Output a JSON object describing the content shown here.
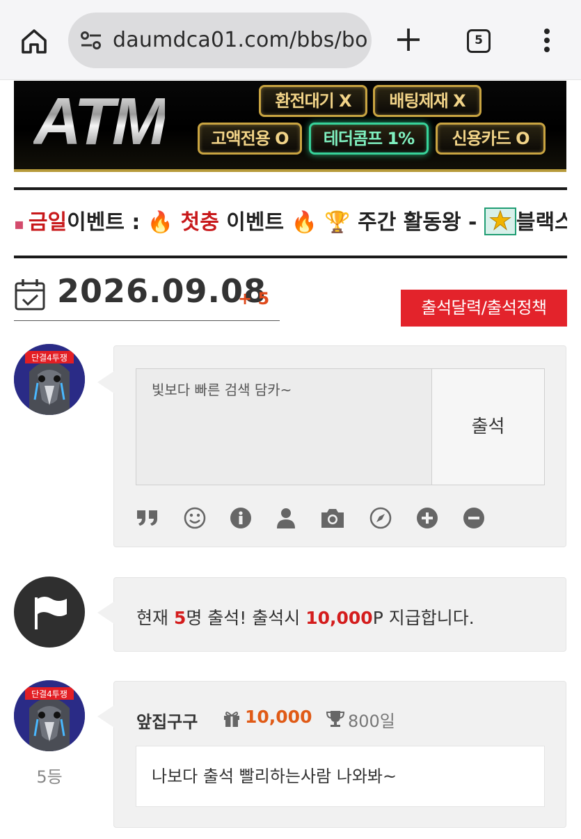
{
  "browser": {
    "url": "daumdca01.com/bbs/bo",
    "tab_count": "5",
    "icons": [
      "home-icon",
      "site-settings-icon",
      "new-tab-icon",
      "tab-switcher-icon",
      "more-menu-icon"
    ]
  },
  "banner": {
    "logo": "ATM",
    "badges": [
      "환전대기 X",
      "배팅제재 X",
      "고액전용 O",
      "테더콤프 1%",
      "신용카드 O"
    ],
    "colors": {
      "gold": "#c9a441",
      "green": "#37d39a"
    }
  },
  "marquee": {
    "segments": [
      {
        "text": "금일",
        "style": "red"
      },
      {
        "text": "이벤트 : ",
        "style": "normal"
      },
      {
        "text": "🔥",
        "style": "emoji"
      },
      {
        "text": " 첫충",
        "style": "red"
      },
      {
        "text": " 이벤트 ",
        "style": "normal"
      },
      {
        "text": "🔥",
        "style": "emoji"
      },
      {
        "text": " 🏆 주간 활동왕 - ",
        "style": "normal"
      },
      {
        "text": "블랙스완",
        "style": "normal"
      }
    ]
  },
  "attendance": {
    "date": "2026.09.08",
    "count": "+ 5",
    "policy_button": "출석달력/출석정책",
    "accent_color": "#e3232b"
  },
  "compose": {
    "placeholder": "빛보다 빠른 검색 담카~",
    "submit": "출석",
    "toolbar_icons": [
      "quote-icon",
      "smile-icon",
      "info-icon",
      "user-icon",
      "camera-icon",
      "compass-icon",
      "plus-circle-icon",
      "minus-circle-icon"
    ]
  },
  "notice": {
    "prefix": "현재 ",
    "count": "5",
    "middle": "명 출석! 출석시 ",
    "points": "10,000",
    "suffix": "P 지급합니다."
  },
  "entry": {
    "username": "앞집구구",
    "points": "10,000",
    "days": "800일",
    "message": "나보다 출석 빨리하는사람 나와봐~",
    "rank": "5등",
    "avatar_badge": "단결4투쟁"
  }
}
